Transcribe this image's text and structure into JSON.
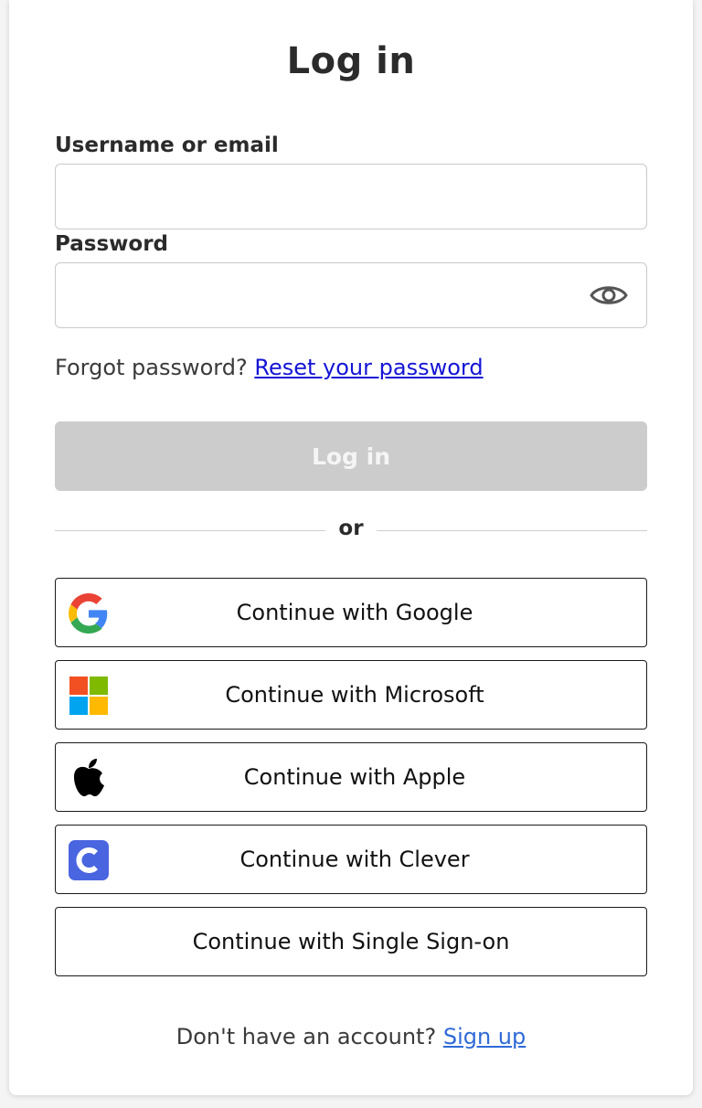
{
  "title": "Log in",
  "username": {
    "label": "Username or email",
    "value": "",
    "placeholder": ""
  },
  "password": {
    "label": "Password",
    "value": "",
    "placeholder": ""
  },
  "forgot": {
    "prompt": "Forgot password?",
    "link": "Reset your password"
  },
  "login_button": "Log in",
  "divider": "or",
  "sso_buttons": [
    {
      "label": "Continue with Google",
      "icon": "google-icon"
    },
    {
      "label": "Continue with Microsoft",
      "icon": "microsoft-icon"
    },
    {
      "label": "Continue with Apple",
      "icon": "apple-icon"
    },
    {
      "label": "Continue with Clever",
      "icon": "clever-icon"
    },
    {
      "label": "Continue with Single Sign-on",
      "icon": ""
    }
  ],
  "signup": {
    "prompt": "Don't have an account?",
    "link": "Sign up"
  },
  "colors": {
    "login_disabled": "#cccccc",
    "reset_link": "#1414d6",
    "signup_link": "#2f6ad8",
    "clever": "#4965e0"
  }
}
